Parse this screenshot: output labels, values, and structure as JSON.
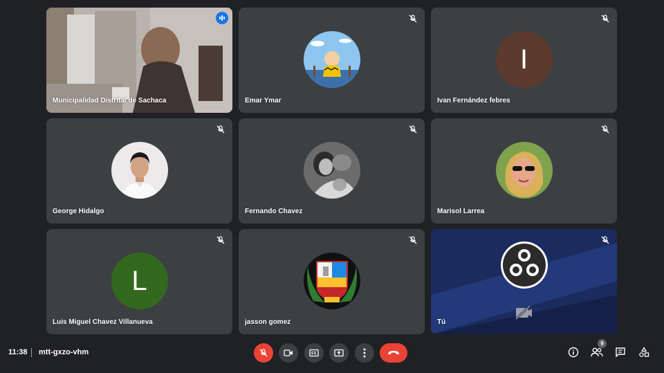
{
  "participants": [
    {
      "name": "Municipalidad Distrital de Sachaca",
      "kind": "video"
    },
    {
      "name": "Emar Ymar",
      "kind": "avatar-image",
      "icon": "cartoon-avatar"
    },
    {
      "name": "Ivan Fernández febres",
      "kind": "letter",
      "initial": "I",
      "color": "#5d3a2e"
    },
    {
      "name": "George Hidalgo",
      "kind": "avatar-image",
      "icon": "profile-photo"
    },
    {
      "name": "Fernando Chavez",
      "kind": "avatar-image",
      "icon": "profile-photo"
    },
    {
      "name": "Marisol Larrea",
      "kind": "avatar-image",
      "icon": "profile-photo"
    },
    {
      "name": "Luis Miguel Chavez Villanueva",
      "kind": "letter",
      "initial": "L",
      "color": "#33691e"
    },
    {
      "name": "jasson gomez",
      "kind": "avatar-image",
      "icon": "coat-of-arms"
    },
    {
      "name": "Tú",
      "kind": "self",
      "icon": "obs-logo"
    }
  ],
  "meeting": {
    "time": "11:38",
    "code": "mtt-gxzo-vhm"
  },
  "people_count": "9",
  "colors": {
    "background": "#202124",
    "tile": "#3c4043",
    "end_call": "#ea4335",
    "active_speaker": "#1a73e8"
  }
}
